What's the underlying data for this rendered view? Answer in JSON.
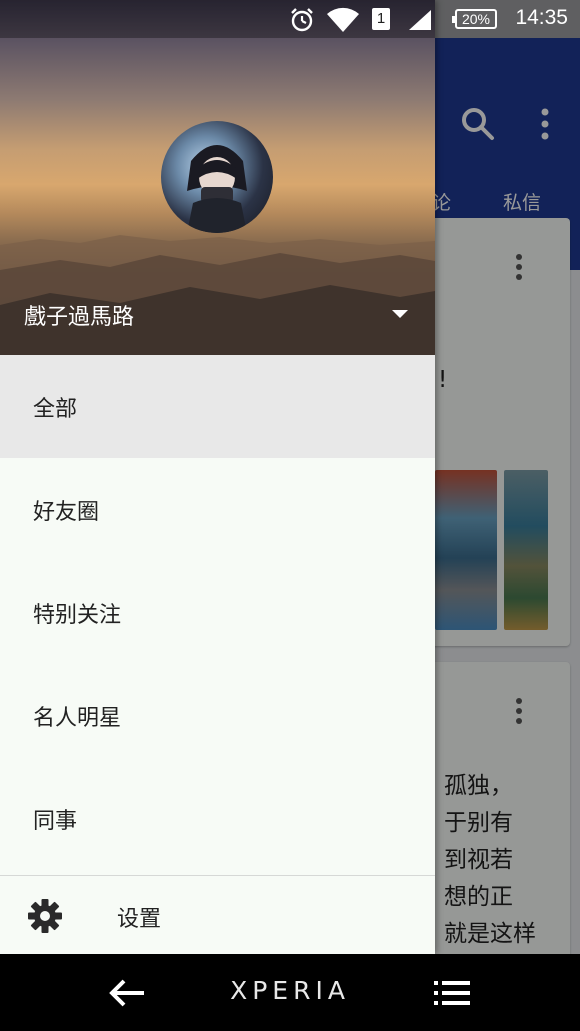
{
  "status_bar": {
    "battery": "20%",
    "sim_slot": "1",
    "time": "14:35",
    "icons": [
      "alarm-icon",
      "wifi-icon",
      "sim-icon",
      "signal-icon",
      "battery-icon"
    ]
  },
  "background_app": {
    "tabs": [
      "论",
      "私信"
    ],
    "card1_text": [
      "!"
    ],
    "card2_text": [
      "孤独，",
      "于别有",
      "到视若",
      "想的正",
      "就是这样"
    ]
  },
  "drawer": {
    "user_name": "戲子過馬路",
    "menu": [
      {
        "label": "全部",
        "active": true
      },
      {
        "label": "好友圈",
        "active": false
      },
      {
        "label": "特别关注",
        "active": false
      },
      {
        "label": "名人明星",
        "active": false
      },
      {
        "label": "同事",
        "active": false
      }
    ],
    "settings_label": "设置"
  },
  "nav_bar": {
    "brand": "XPERIA",
    "icons": [
      "back-arrow-icon",
      "menu-lines-icon"
    ]
  },
  "colors": {
    "app_bar": "#1f3a93",
    "drawer_bg": "#f7fbf6",
    "active_item": "#e8e8e8"
  }
}
